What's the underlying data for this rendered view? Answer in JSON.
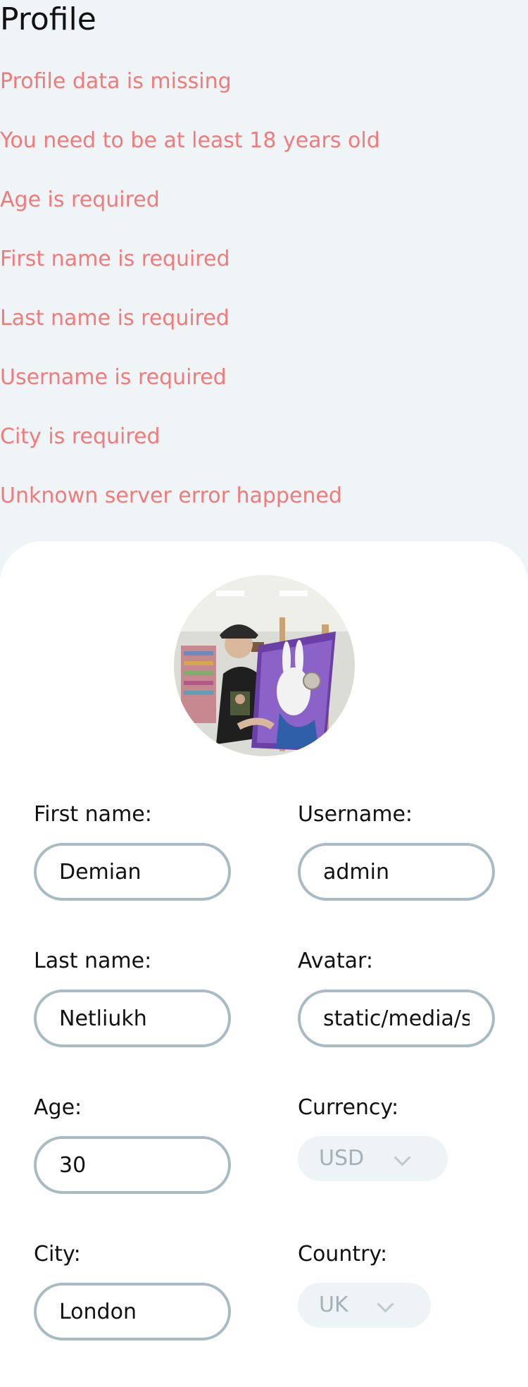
{
  "page": {
    "title": "Profile"
  },
  "errors": [
    "Profile data is missing",
    "You need to be at least 18 years old",
    "Age is required",
    "First name is required",
    "Last name is required",
    "Username is required",
    "City is required",
    "Unknown server error happened"
  ],
  "form": {
    "first_name": {
      "label": "First name:",
      "value": "Demian"
    },
    "last_name": {
      "label": "Last name:",
      "value": "Netliukh"
    },
    "age": {
      "label": "Age:",
      "value": "30"
    },
    "city": {
      "label": "City:",
      "value": "London"
    },
    "username": {
      "label": "Username:",
      "value": "admin"
    },
    "avatar": {
      "label": "Avatar:",
      "value": "static/media/sr"
    },
    "currency": {
      "label": "Currency:",
      "selected": "USD"
    },
    "country": {
      "label": "Country:",
      "selected": "UK"
    }
  },
  "colors": {
    "background": "#eff4f7",
    "error_text": "#f27a7a",
    "input_border": "#a8bac3",
    "select_bg": "#eef3f5",
    "select_text": "#a3b1b8"
  }
}
